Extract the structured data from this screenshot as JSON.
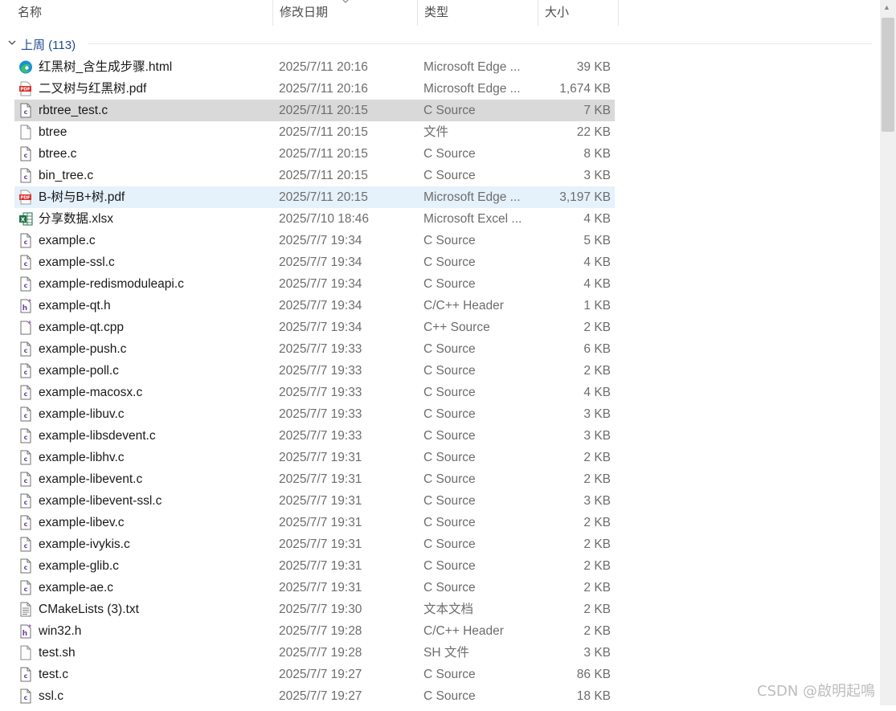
{
  "columns": {
    "name": "名称",
    "modified": "修改日期",
    "type": "类型",
    "size": "大小"
  },
  "group": {
    "label": "上周 (113)"
  },
  "files": [
    {
      "name": "红黑树_含生成步骤.html",
      "date": "2025/7/11 20:16",
      "type": "Microsoft Edge ...",
      "size": "39 KB",
      "icon": "edge-icon"
    },
    {
      "name": "二叉树与红黑树.pdf",
      "date": "2025/7/11 20:16",
      "type": "Microsoft Edge ...",
      "size": "1,674 KB",
      "icon": "pdf-icon"
    },
    {
      "name": "rbtree_test.c",
      "date": "2025/7/11 20:15",
      "type": "C Source",
      "size": "7 KB",
      "icon": "c-file-icon",
      "state": "selected"
    },
    {
      "name": "btree",
      "date": "2025/7/11 20:15",
      "type": "文件",
      "size": "22 KB",
      "icon": "blank-file-icon"
    },
    {
      "name": "btree.c",
      "date": "2025/7/11 20:15",
      "type": "C Source",
      "size": "8 KB",
      "icon": "c-file-icon"
    },
    {
      "name": "bin_tree.c",
      "date": "2025/7/11 20:15",
      "type": "C Source",
      "size": "3 KB",
      "icon": "c-file-icon"
    },
    {
      "name": "B-树与B+树.pdf",
      "date": "2025/7/11 20:15",
      "type": "Microsoft Edge ...",
      "size": "3,197 KB",
      "icon": "pdf-icon",
      "state": "hover"
    },
    {
      "name": "分享数据.xlsx",
      "date": "2025/7/10 18:46",
      "type": "Microsoft Excel ...",
      "size": "4 KB",
      "icon": "excel-icon"
    },
    {
      "name": "example.c",
      "date": "2025/7/7 19:34",
      "type": "C Source",
      "size": "5 KB",
      "icon": "c-file-icon"
    },
    {
      "name": "example-ssl.c",
      "date": "2025/7/7 19:34",
      "type": "C Source",
      "size": "4 KB",
      "icon": "c-file-icon"
    },
    {
      "name": "example-redismoduleapi.c",
      "date": "2025/7/7 19:34",
      "type": "C Source",
      "size": "4 KB",
      "icon": "c-file-icon"
    },
    {
      "name": "example-qt.h",
      "date": "2025/7/7 19:34",
      "type": "C/C++ Header",
      "size": "1 KB",
      "icon": "header-file-icon"
    },
    {
      "name": "example-qt.cpp",
      "date": "2025/7/7 19:34",
      "type": "C++ Source",
      "size": "2 KB",
      "icon": "cpp-file-icon"
    },
    {
      "name": "example-push.c",
      "date": "2025/7/7 19:33",
      "type": "C Source",
      "size": "6 KB",
      "icon": "c-file-icon"
    },
    {
      "name": "example-poll.c",
      "date": "2025/7/7 19:33",
      "type": "C Source",
      "size": "2 KB",
      "icon": "c-file-icon"
    },
    {
      "name": "example-macosx.c",
      "date": "2025/7/7 19:33",
      "type": "C Source",
      "size": "4 KB",
      "icon": "c-file-icon"
    },
    {
      "name": "example-libuv.c",
      "date": "2025/7/7 19:33",
      "type": "C Source",
      "size": "3 KB",
      "icon": "c-file-icon"
    },
    {
      "name": "example-libsdevent.c",
      "date": "2025/7/7 19:33",
      "type": "C Source",
      "size": "3 KB",
      "icon": "c-file-icon"
    },
    {
      "name": "example-libhv.c",
      "date": "2025/7/7 19:31",
      "type": "C Source",
      "size": "2 KB",
      "icon": "c-file-icon"
    },
    {
      "name": "example-libevent.c",
      "date": "2025/7/7 19:31",
      "type": "C Source",
      "size": "2 KB",
      "icon": "c-file-icon"
    },
    {
      "name": "example-libevent-ssl.c",
      "date": "2025/7/7 19:31",
      "type": "C Source",
      "size": "3 KB",
      "icon": "c-file-icon"
    },
    {
      "name": "example-libev.c",
      "date": "2025/7/7 19:31",
      "type": "C Source",
      "size": "2 KB",
      "icon": "c-file-icon"
    },
    {
      "name": "example-ivykis.c",
      "date": "2025/7/7 19:31",
      "type": "C Source",
      "size": "2 KB",
      "icon": "c-file-icon"
    },
    {
      "name": "example-glib.c",
      "date": "2025/7/7 19:31",
      "type": "C Source",
      "size": "2 KB",
      "icon": "c-file-icon"
    },
    {
      "name": "example-ae.c",
      "date": "2025/7/7 19:31",
      "type": "C Source",
      "size": "2 KB",
      "icon": "c-file-icon"
    },
    {
      "name": "CMakeLists (3).txt",
      "date": "2025/7/7 19:30",
      "type": "文本文档",
      "size": "2 KB",
      "icon": "text-file-icon"
    },
    {
      "name": "win32.h",
      "date": "2025/7/7 19:28",
      "type": "C/C++ Header",
      "size": "2 KB",
      "icon": "header-file-icon"
    },
    {
      "name": "test.sh",
      "date": "2025/7/7 19:28",
      "type": "SH 文件",
      "size": "3 KB",
      "icon": "blank-file-icon"
    },
    {
      "name": "test.c",
      "date": "2025/7/7 19:27",
      "type": "C Source",
      "size": "86 KB",
      "icon": "c-file-icon"
    },
    {
      "name": "ssl.c",
      "date": "2025/7/7 19:27",
      "type": "C Source",
      "size": "18 KB",
      "icon": "c-file-icon"
    }
  ],
  "colors": {
    "selected": "#d9d9d9",
    "hover": "#e5f1fb",
    "group_label": "#1e4a8c",
    "pdf_red": "#d9302c",
    "excel_green": "#1d6f42",
    "edge_blue": "#1a8fd6"
  },
  "watermark": "CSDN @啟明起鳴"
}
